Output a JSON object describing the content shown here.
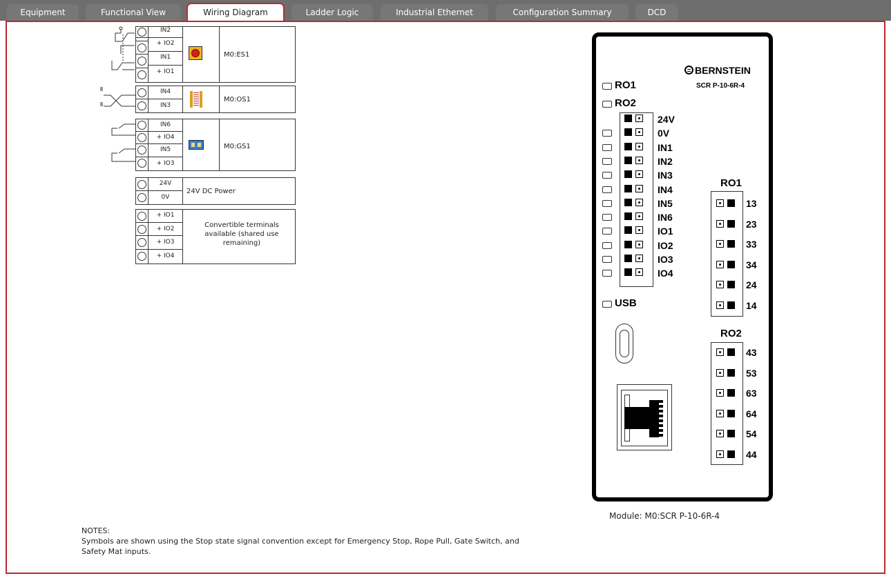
{
  "tabs": [
    {
      "label": "Equipment"
    },
    {
      "label": "Functional View"
    },
    {
      "label": "Wiring Diagram"
    },
    {
      "label": "Ladder Logic"
    },
    {
      "label": "Industrial Ethernet"
    },
    {
      "label": "Configuration Summary"
    },
    {
      "label": "DCD"
    }
  ],
  "active_tab": "Wiring Diagram",
  "blocks": {
    "es1": {
      "terminals": [
        "IN2",
        "+ IO2",
        "IN1",
        "+ IO1"
      ],
      "device": "M0:ES1"
    },
    "os1": {
      "terminals": [
        "IN4",
        "IN3"
      ],
      "device": "M0:OS1"
    },
    "gs1": {
      "terminals": [
        "IN6",
        "+ IO4",
        "IN5",
        "+ IO3"
      ],
      "device": "M0:GS1"
    },
    "power": {
      "terminals": [
        "24V",
        "0V"
      ],
      "device": "24V DC Power"
    },
    "conv": {
      "terminals": [
        "+ IO1",
        "+ IO2",
        "+ IO3",
        "+ IO4"
      ],
      "device": "Convertible terminals available (shared use remaining)"
    }
  },
  "module": {
    "brand": "BERNSTEIN",
    "model": "SCR P-10-6R-4",
    "ro1_label": "RO1",
    "ro2_label": "RO2",
    "usb_label": "USB",
    "inputs": [
      "24V",
      "0V",
      "IN1",
      "IN2",
      "IN3",
      "IN4",
      "IN5",
      "IN6",
      "IO1",
      "IO2",
      "IO3",
      "IO4"
    ],
    "ro1_terms": [
      "13",
      "23",
      "33",
      "34",
      "24",
      "14"
    ],
    "ro2_terms": [
      "43",
      "53",
      "63",
      "64",
      "54",
      "44"
    ],
    "caption": "Module:  M0:SCR P-10-6R-4"
  },
  "notes": {
    "title": "NOTES:",
    "line1": "Symbols are shown using the Stop state signal convention except for Emergency Stop, Rope Pull, Gate Switch, and",
    "line2": "Safety Mat inputs."
  },
  "colors": {
    "accent": "#c0282d",
    "tabbar": "#6e6e6e"
  }
}
